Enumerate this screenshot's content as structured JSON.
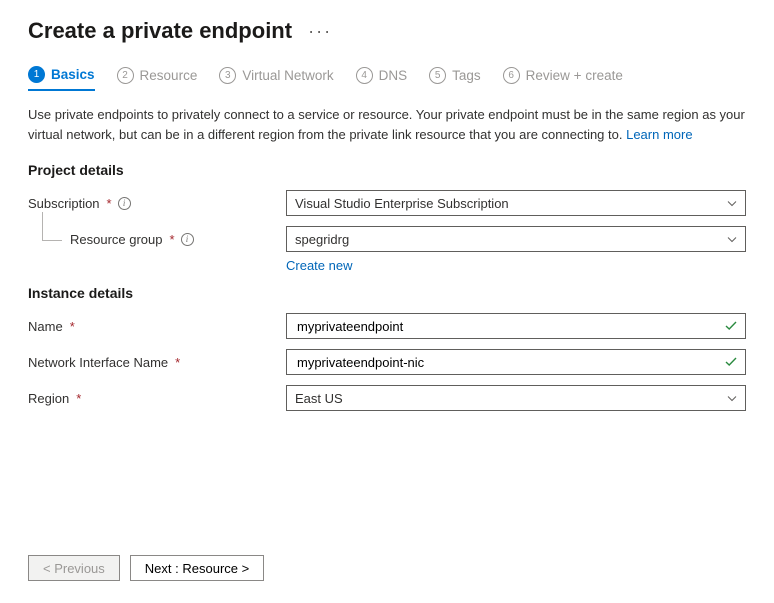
{
  "title": "Create a private endpoint",
  "tabs": [
    {
      "num": "1",
      "label": "Basics"
    },
    {
      "num": "2",
      "label": "Resource"
    },
    {
      "num": "3",
      "label": "Virtual Network"
    },
    {
      "num": "4",
      "label": "DNS"
    },
    {
      "num": "5",
      "label": "Tags"
    },
    {
      "num": "6",
      "label": "Review + create"
    }
  ],
  "description": "Use private endpoints to privately connect to a service or resource. Your private endpoint must be in the same region as your virtual network, but can be in a different region from the private link resource that you are connecting to. ",
  "learn_more": "Learn more",
  "sections": {
    "project": {
      "heading": "Project details",
      "subscription_label": "Subscription",
      "subscription_value": "Visual Studio Enterprise Subscription",
      "rg_label": "Resource group",
      "rg_value": "spegridrg",
      "create_new": "Create new"
    },
    "instance": {
      "heading": "Instance details",
      "name_label": "Name",
      "name_value": "myprivateendpoint",
      "nic_label": "Network Interface Name",
      "nic_value": "myprivateendpoint-nic",
      "region_label": "Region",
      "region_value": "East US"
    }
  },
  "footer": {
    "prev": "< Previous",
    "next": "Next : Resource >"
  }
}
